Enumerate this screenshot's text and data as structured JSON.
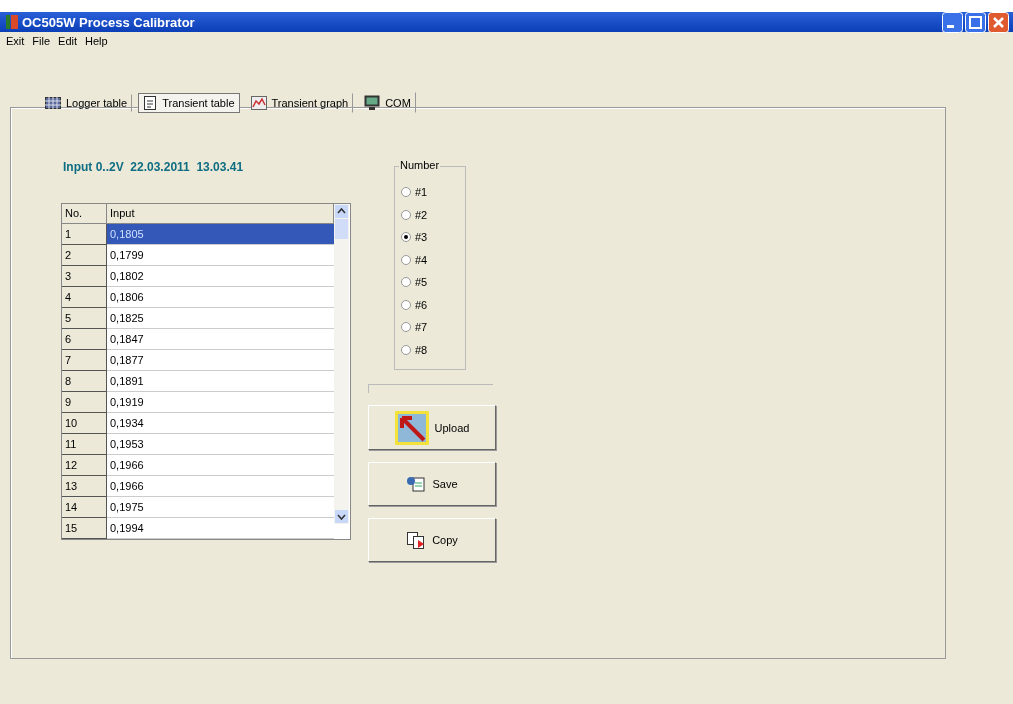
{
  "window": {
    "title": "OC505W Process Calibrator"
  },
  "menu": [
    "Exit",
    "File",
    "Edit",
    "Help"
  ],
  "tabs": [
    {
      "label": "Logger table",
      "kind": "grid",
      "selected": false
    },
    {
      "label": "Transient table",
      "kind": "doc",
      "selected": true
    },
    {
      "label": "Transient graph",
      "kind": "graph",
      "selected": false
    },
    {
      "label": "COM",
      "kind": "monitor",
      "selected": false
    }
  ],
  "heading": "Input 0..2V  22.03.2011  13.03.41",
  "table": {
    "columns": [
      "No.",
      "Input"
    ],
    "rows": [
      {
        "cells": [
          "1",
          "0,1805"
        ],
        "selected": true
      },
      {
        "cells": [
          "2",
          "0,1799"
        ],
        "selected": false
      },
      {
        "cells": [
          "3",
          "0,1802"
        ],
        "selected": false
      },
      {
        "cells": [
          "4",
          "0,1806"
        ],
        "selected": false
      },
      {
        "cells": [
          "5",
          "0,1825"
        ],
        "selected": false
      },
      {
        "cells": [
          "6",
          "0,1847"
        ],
        "selected": false
      },
      {
        "cells": [
          "7",
          "0,1877"
        ],
        "selected": false
      },
      {
        "cells": [
          "8",
          "0,1891"
        ],
        "selected": false
      },
      {
        "cells": [
          "9",
          "0,1919"
        ],
        "selected": false
      },
      {
        "cells": [
          "10",
          "0,1934"
        ],
        "selected": false
      },
      {
        "cells": [
          "11",
          "0,1953"
        ],
        "selected": false
      },
      {
        "cells": [
          "12",
          "0,1966"
        ],
        "selected": false
      },
      {
        "cells": [
          "13",
          "0,1966"
        ],
        "selected": false
      },
      {
        "cells": [
          "14",
          "0,1975"
        ],
        "selected": false
      },
      {
        "cells": [
          "15",
          "0,1994"
        ],
        "selected": false
      }
    ]
  },
  "number_group": {
    "title": "Number",
    "options": [
      {
        "label": "#1",
        "selected": false
      },
      {
        "label": "#2",
        "selected": false
      },
      {
        "label": "#3",
        "selected": true
      },
      {
        "label": "#4",
        "selected": false
      },
      {
        "label": "#5",
        "selected": false
      },
      {
        "label": "#6",
        "selected": false
      },
      {
        "label": "#7",
        "selected": false
      },
      {
        "label": "#8",
        "selected": false
      }
    ]
  },
  "buttons": [
    {
      "label": "Upload",
      "kind": "upload"
    },
    {
      "label": "Save",
      "kind": "save"
    },
    {
      "label": "Copy",
      "kind": "copy"
    }
  ]
}
